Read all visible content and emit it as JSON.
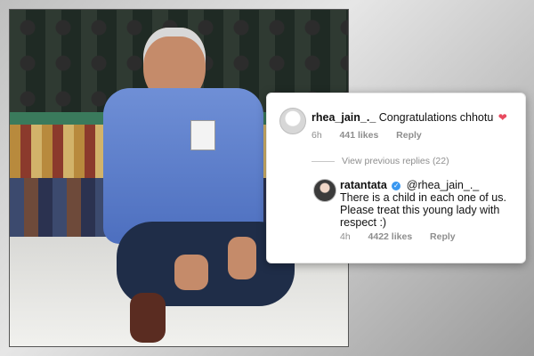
{
  "comment_card": {
    "comment1": {
      "username": "rhea_jain_._",
      "text": "Congratulations chhotu",
      "emoji": "❤",
      "time": "6h",
      "likes": "441 likes",
      "reply": "Reply"
    },
    "view_previous": "View previous replies (22)",
    "reply1": {
      "username": "ratantata",
      "mention": "@rhea_jain_._",
      "text": "There is a child in each one of us. Please treat this young lady with respect :)",
      "time": "4h",
      "likes": "4422 likes",
      "reply": "Reply"
    }
  }
}
